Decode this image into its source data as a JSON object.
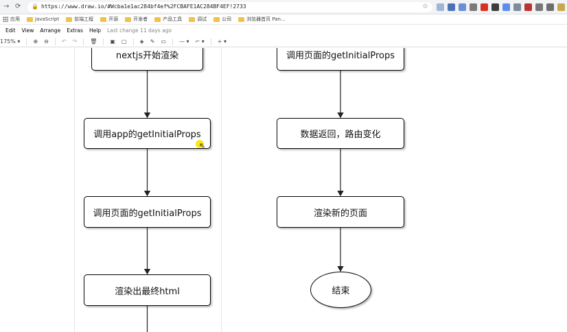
{
  "browser": {
    "url": "https://www.draw.io/#Wcba1e1ac284bf4ef%2FCBAFE1AC284BF4EF!2733",
    "bookmarks": [
      {
        "label": "应用",
        "type": "apps"
      },
      {
        "label": "JavaScript",
        "type": "folder"
      },
      {
        "label": "前端工程",
        "type": "folder"
      },
      {
        "label": "开源",
        "type": "folder"
      },
      {
        "label": "开发者",
        "type": "folder"
      },
      {
        "label": "产品工具",
        "type": "folder"
      },
      {
        "label": "调试",
        "type": "folder"
      },
      {
        "label": "公司",
        "type": "folder"
      },
      {
        "label": "浏览器首页 Pan...",
        "type": "folder"
      }
    ],
    "extension_colors": [
      "#9fb7d6",
      "#4a72b6",
      "#6b8ed6",
      "#7a7a7a",
      "#d93025",
      "#3d3d3d",
      "#5b8def",
      "#7f8c9a",
      "#b33",
      "#777",
      "#6d6d6d",
      "#c7a94d",
      "#999"
    ]
  },
  "menu": {
    "items": [
      "Edit",
      "View",
      "Arrange",
      "Extras",
      "Help"
    ],
    "last_change": "Last change 11 days ago"
  },
  "toolbar": {
    "zoom": "175%"
  },
  "diagram": {
    "left": [
      "nextjs开始渲染",
      "调用app的getInitialProps",
      "调用页面的getInitialProps",
      "渲染出最终html"
    ],
    "right": [
      "调用页面的getInitialProps",
      "数据返回，路由变化",
      "渲染新的页面",
      "结束"
    ]
  },
  "colors": {
    "node_border": "#000000",
    "cursor_highlight": "#f5e600"
  }
}
